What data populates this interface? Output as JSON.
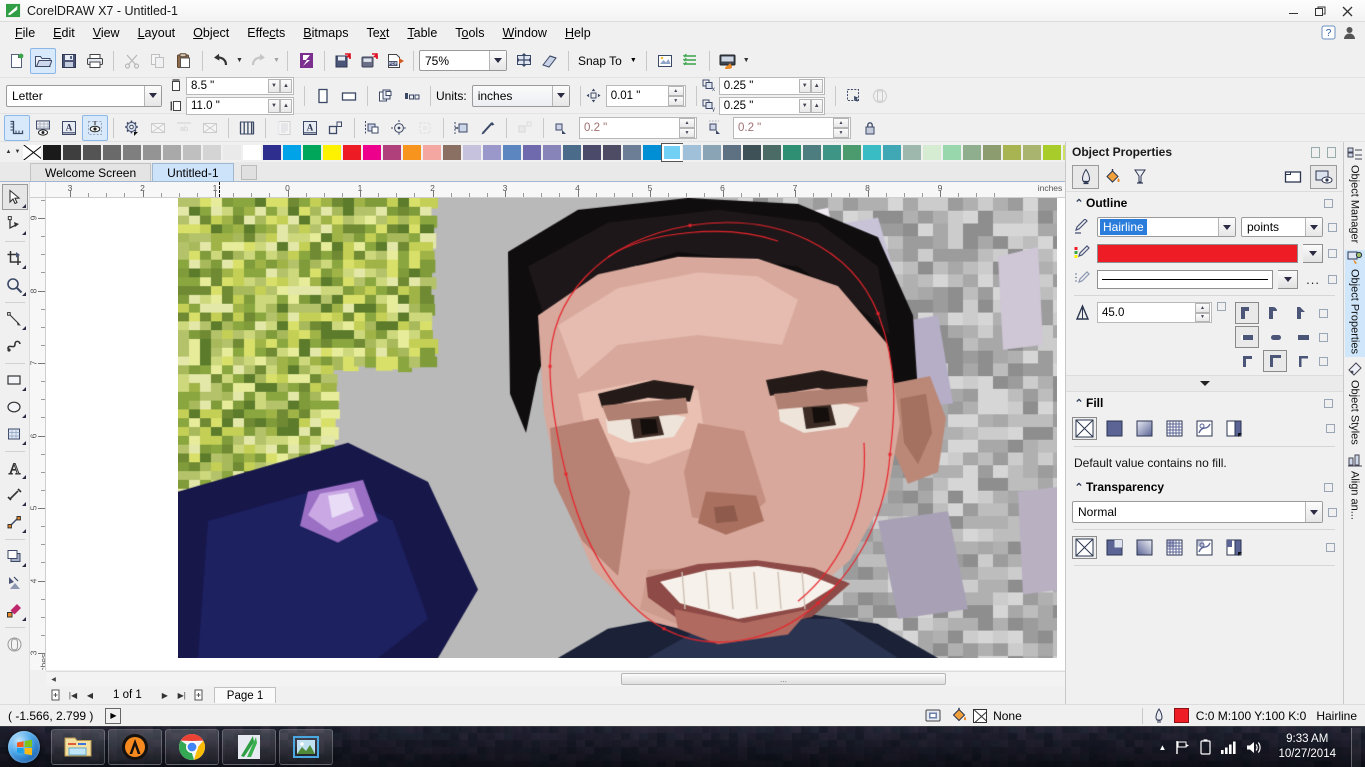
{
  "window": {
    "title": "CorelDRAW X7 - Untitled-1",
    "logo_icon": "coreldraw-logo-icon",
    "buttons": [
      {
        "name": "minimize",
        "glyph": "–"
      },
      {
        "name": "restore",
        "glyph": "❐"
      },
      {
        "name": "close",
        "glyph": "✕"
      }
    ]
  },
  "menubar": {
    "items": [
      "File",
      "Edit",
      "View",
      "Layout",
      "Object",
      "Effects",
      "Bitmaps",
      "Text",
      "Table",
      "Tools",
      "Window",
      "Help"
    ],
    "right_icons": [
      "help-icon",
      "user-icon"
    ]
  },
  "standard_toolbar": {
    "items": [
      {
        "name": "new-button",
        "icon": "new-document-icon",
        "state": "normal"
      },
      {
        "name": "open-button",
        "icon": "open-folder-icon",
        "state": "active"
      },
      {
        "name": "save-button",
        "icon": "save-disk-icon",
        "state": "normal"
      },
      {
        "name": "print-button",
        "icon": "printer-icon",
        "state": "normal"
      },
      {
        "name": "cut-button",
        "icon": "scissors-icon",
        "state": "disabled"
      },
      {
        "name": "copy-button",
        "icon": "copy-icon",
        "state": "disabled"
      },
      {
        "name": "paste-button",
        "icon": "paste-icon",
        "state": "normal"
      },
      {
        "name": "undo-button",
        "icon": "undo-arrow-icon",
        "state": "normal"
      },
      {
        "name": "redo-button",
        "icon": "redo-arrow-icon",
        "state": "disabled"
      },
      {
        "name": "import-button",
        "icon": "import-icon",
        "state": "normal"
      },
      {
        "name": "export-button",
        "icon": "export-icon",
        "state": "normal"
      },
      {
        "name": "publish-pdf-button",
        "icon": "pdf-icon",
        "state": "normal"
      }
    ],
    "zoom_level": "75%",
    "snap_to_label": "Snap To",
    "fullscreen_icon": "fullscreen-preview-icon",
    "options_icon": "options-icon",
    "launch_icon": "application-launcher-icon"
  },
  "property_bar": {
    "page_size": "Letter",
    "page_width": "8.5 \"",
    "page_height": "11.0 \"",
    "width_icon": "page-width-icon",
    "height_icon": "page-height-icon",
    "portrait_icon": "portrait-orientation-icon",
    "landscape_icon": "landscape-orientation-icon",
    "all_pages_icon": "all-pages-icon",
    "current_page_icon": "current-page-icon",
    "units_label": "Units:",
    "units_value": "inches",
    "nudge_icon": "nudge-offset-icon",
    "nudge_value": "0.01 \"",
    "duplicate_x_icon": "duplicate-distance-x-icon",
    "duplicate_y_icon": "duplicate-distance-y-icon",
    "duplicate_x": "0.25 \"",
    "duplicate_y": "0.25 \"",
    "treat_as_filled_icon": "treat-as-filled-icon",
    "wrap_text_icon": "wrap-paragraph-text-icon"
  },
  "toolbar3": {
    "items": [
      {
        "name": "show-rulers-button",
        "icon": "ruler-icon",
        "state": "active"
      },
      {
        "name": "show-grid-button",
        "icon": "grid-eye-icon",
        "state": "normal"
      },
      {
        "name": "show-guidelines-button",
        "icon": "guidelines-text-icon",
        "state": "normal"
      },
      {
        "name": "show-baseline-grid-button",
        "icon": "baseline-eye-icon",
        "state": "active"
      },
      {
        "name": "snap-settings-button",
        "icon": "gear-icon",
        "state": "normal"
      },
      {
        "name": "no-snap-a-button",
        "icon": "x-box-icon",
        "state": "disabled"
      },
      {
        "name": "tab-snap-button",
        "icon": "tab-icon",
        "state": "disabled"
      },
      {
        "name": "no-snap-b-button",
        "icon": "x-box-icon",
        "state": "disabled"
      },
      {
        "name": "column-guides-button",
        "icon": "columns-icon",
        "state": "normal"
      },
      {
        "name": "text-frame-button",
        "icon": "text-frame-icon",
        "state": "disabled"
      },
      {
        "name": "text-box-button",
        "icon": "text-a-icon",
        "state": "normal"
      },
      {
        "name": "object-corner-button",
        "icon": "object-corner-icon",
        "state": "normal"
      },
      {
        "name": "align-objects-button",
        "icon": "align-objects-icon",
        "state": "normal"
      },
      {
        "name": "dynamic-guides-button",
        "icon": "dynamic-guides-icon",
        "state": "normal"
      },
      {
        "name": "alignment-guides-button",
        "icon": "alignment-guides-icon",
        "state": "disabled"
      },
      {
        "name": "distribute-button",
        "icon": "distribute-icon",
        "state": "disabled"
      },
      {
        "name": "margin-object-button",
        "icon": "margin-object-icon",
        "state": "normal"
      },
      {
        "name": "pick-margin-button",
        "icon": "pick-margin-icon",
        "state": "normal"
      },
      {
        "name": "margin-spacing-a-button",
        "icon": "spacing-small-icon",
        "state": "disabled"
      },
      {
        "name": "margin-corner-button",
        "icon": "margin-corner-icon",
        "state": "normal"
      },
      {
        "name": "margin-corner2-button",
        "icon": "margin-corner2-icon",
        "state": "normal"
      },
      {
        "name": "lock-margins-button",
        "icon": "lock-icon",
        "state": "normal"
      }
    ],
    "margin_a": "0.2 \"",
    "margin_b": "0.2 \""
  },
  "palette": {
    "nav_left_icon": "palette-scroll-up-icon",
    "nav_right_icon": "palette-scroll-down-icon",
    "expand_icon": "palette-expand-icon",
    "none_swatch": "no-color-swatch",
    "selected_index": 31,
    "colors": [
      "#1a1a1a",
      "#3e3e3e",
      "#545454",
      "#6a6a6a",
      "#7f7f7f",
      "#949494",
      "#a9a9a9",
      "#bfbfbf",
      "#d4d4d4",
      "#eaeaea",
      "#ffffff",
      "#2e2e8f",
      "#00a2e8",
      "#00a65a",
      "#fff200",
      "#ed1c24",
      "#ec008c",
      "#b0407c",
      "#f7941e",
      "#f4a6a0",
      "#8a6f63",
      "#c6c2de",
      "#9a97cb",
      "#5b86c0",
      "#6f6aae",
      "#8684b8",
      "#4a6b8a",
      "#4c4a6b",
      "#4e4c64",
      "#6c7d96",
      "#008fd5",
      "#72d0f4",
      "#9fc0d8",
      "#8ba4b5",
      "#5d7183",
      "#3d5157",
      "#4a6b66",
      "#2f8f72",
      "#4e7d80",
      "#3f9585",
      "#4c9b6f",
      "#39bcc4",
      "#3fa8b4",
      "#9fb8ad",
      "#d5ecd2",
      "#98d6ab",
      "#8fae8e",
      "#8d9c6e",
      "#a8b352",
      "#a9b46f",
      "#a8cc29",
      "#cde05f",
      "#4d523a",
      "#7d7f63",
      "#a9a584",
      "#b0a561"
    ]
  },
  "doc_tabs": {
    "items": [
      {
        "label": "Welcome Screen",
        "active": false
      },
      {
        "label": "Untitled-1",
        "active": true
      }
    ],
    "new_tab_icon": "new-tab-icon"
  },
  "toolbox": {
    "items": [
      {
        "name": "pick-tool",
        "icon": "arrow-cursor-icon",
        "active": true,
        "flyout": true
      },
      {
        "name": "shape-tool",
        "icon": "shape-node-icon",
        "active": false,
        "flyout": true
      },
      {
        "name": "crop-tool",
        "icon": "crop-icon",
        "active": false,
        "flyout": true
      },
      {
        "name": "zoom-tool",
        "icon": "magnifier-icon",
        "active": false,
        "flyout": true
      },
      {
        "name": "freehand-tool",
        "icon": "freehand-line-icon",
        "active": false,
        "flyout": true
      },
      {
        "name": "artistic-media-tool",
        "icon": "artistic-media-icon",
        "active": false,
        "flyout": false
      },
      {
        "name": "rectangle-tool",
        "icon": "rectangle-icon",
        "active": false,
        "flyout": true
      },
      {
        "name": "ellipse-tool",
        "icon": "ellipse-icon",
        "active": false,
        "flyout": true
      },
      {
        "name": "polygon-tool",
        "icon": "polygon-grid-icon",
        "active": false,
        "flyout": true
      },
      {
        "name": "text-tool",
        "icon": "text-a-icon",
        "active": false,
        "flyout": true
      },
      {
        "name": "parallel-dimension-tool",
        "icon": "dimension-icon",
        "active": false,
        "flyout": true
      },
      {
        "name": "connector-tool",
        "icon": "connector-icon",
        "active": false,
        "flyout": true
      },
      {
        "name": "shadow-tool",
        "icon": "drop-shadow-icon",
        "active": false,
        "flyout": true
      },
      {
        "name": "transparency-tool",
        "icon": "transparency-icon",
        "active": false,
        "flyout": false
      },
      {
        "name": "color-eyedropper-tool",
        "icon": "eyedropper-icon",
        "active": false,
        "flyout": true
      },
      {
        "name": "interactive-fill-tool",
        "icon": "fill-cylinder-icon",
        "active": false,
        "flyout": false
      }
    ]
  },
  "rulers": {
    "units_label": "inches",
    "h_ticks": [
      "3",
      "2",
      "1",
      "0",
      "1",
      "2",
      "3",
      "4",
      "5",
      "6",
      "7",
      "8",
      "9"
    ],
    "v_ticks": [
      "3",
      "4",
      "5",
      "6",
      "7",
      "8",
      "9"
    ],
    "v_units_label": "inches"
  },
  "docker": {
    "title": "Object Properties",
    "pin_icon": "auto-hide-icon",
    "close_icon": "close-docker-icon",
    "tabs": [
      {
        "name": "outline-tab",
        "icon": "outline-pen-icon",
        "active": true
      },
      {
        "name": "fill-tab",
        "icon": "fill-bucket-icon",
        "active": false
      },
      {
        "name": "transparency-tab",
        "icon": "transparency-glass-icon",
        "active": false
      },
      {
        "name": "rectangle-props-tab",
        "icon": "rectangle-props-icon",
        "active": false
      },
      {
        "name": "summary-tab",
        "icon": "summary-eye-icon",
        "active": true
      }
    ],
    "outline": {
      "header": "Outline",
      "width_value": "Hairline",
      "width_units": "points",
      "width_icon": "outline-width-pen-icon",
      "color_icon": "outline-color-pen-icon",
      "color_hex": "#ee1c25",
      "style_icon": "outline-style-pen-icon",
      "more_label": "...",
      "miter_icon": "miter-limit-icon",
      "miter_value": "45.0",
      "corner_buttons": [
        "miter-corner-icon",
        "round-corner-icon",
        "bevel-corner-icon"
      ],
      "cap_buttons": [
        "butt-cap-icon",
        "round-cap-icon",
        "extended-cap-icon"
      ],
      "arrow_buttons": [
        "behind-fill-icon",
        "scale-with-object-icon",
        "overprint-outline-icon"
      ],
      "selected_corner": 0,
      "selected_cap": 0,
      "selected_arrow": 1
    },
    "fill": {
      "header": "Fill",
      "buttons": [
        "no-fill-icon",
        "uniform-fill-icon",
        "fountain-fill-icon",
        "vector-pattern-icon",
        "bitmap-pattern-icon",
        "two-color-pattern-icon"
      ],
      "selected": 0,
      "message": "Default value contains no fill."
    },
    "transparency": {
      "header": "Transparency",
      "merge_mode": "Normal",
      "buttons": [
        "no-transparency-icon",
        "uniform-transparency-icon",
        "fountain-transparency-icon",
        "vector-pattern-transparency-icon",
        "bitmap-pattern-transparency-icon",
        "two-color-transparency-icon"
      ],
      "selected": 0
    }
  },
  "vtabs": [
    {
      "label": "Object Manager",
      "icon": "object-manager-icon",
      "active": false
    },
    {
      "label": "Object Properties",
      "icon": "object-properties-icon",
      "active": true
    },
    {
      "label": "Object Styles",
      "icon": "object-styles-icon",
      "active": false
    },
    {
      "label": "Align an...",
      "icon": "align-distribute-icon",
      "active": false
    }
  ],
  "pagebar": {
    "add_page_start_icon": "add-page-before-icon",
    "first_icon": "first-page-icon",
    "prev_icon": "previous-page-icon",
    "counter": "1 of 1",
    "next_icon": "next-page-icon",
    "last_icon": "last-page-icon",
    "add_page_end_icon": "add-page-after-icon",
    "page_tab": "Page 1"
  },
  "statusbar": {
    "coords": "( -1.566, 2.799 )",
    "expand_icon": "expand-statusbar-icon",
    "screen_icon": "color-proof-icon",
    "fill_icon": "fill-bucket-icon",
    "fill_value": "None",
    "outline_icon": "outline-pen-icon",
    "outline_color_hex": "#ee1c25",
    "outline_cmyk": "C:0 M:100 Y:100 K:0",
    "outline_width": "Hairline"
  },
  "taskbar": {
    "start_icon": "windows-start-orb-icon",
    "items": [
      {
        "name": "taskbar-explorer",
        "icon": "file-explorer-icon"
      },
      {
        "name": "taskbar-avast",
        "icon": "avast-shield-icon"
      },
      {
        "name": "taskbar-chrome",
        "icon": "google-chrome-icon"
      },
      {
        "name": "taskbar-coreldraw",
        "icon": "coreldraw-icon"
      },
      {
        "name": "taskbar-photo",
        "icon": "photo-viewer-icon"
      }
    ],
    "tray": [
      {
        "name": "tray-show-hidden",
        "icon": "chevron-up-icon"
      },
      {
        "name": "tray-network",
        "icon": "network-flag-icon"
      },
      {
        "name": "tray-battery",
        "icon": "battery-icon"
      },
      {
        "name": "tray-signal",
        "icon": "signal-bars-icon"
      },
      {
        "name": "tray-volume",
        "icon": "speaker-icon"
      }
    ],
    "time": "9:33 AM",
    "date": "10/27/2014"
  }
}
